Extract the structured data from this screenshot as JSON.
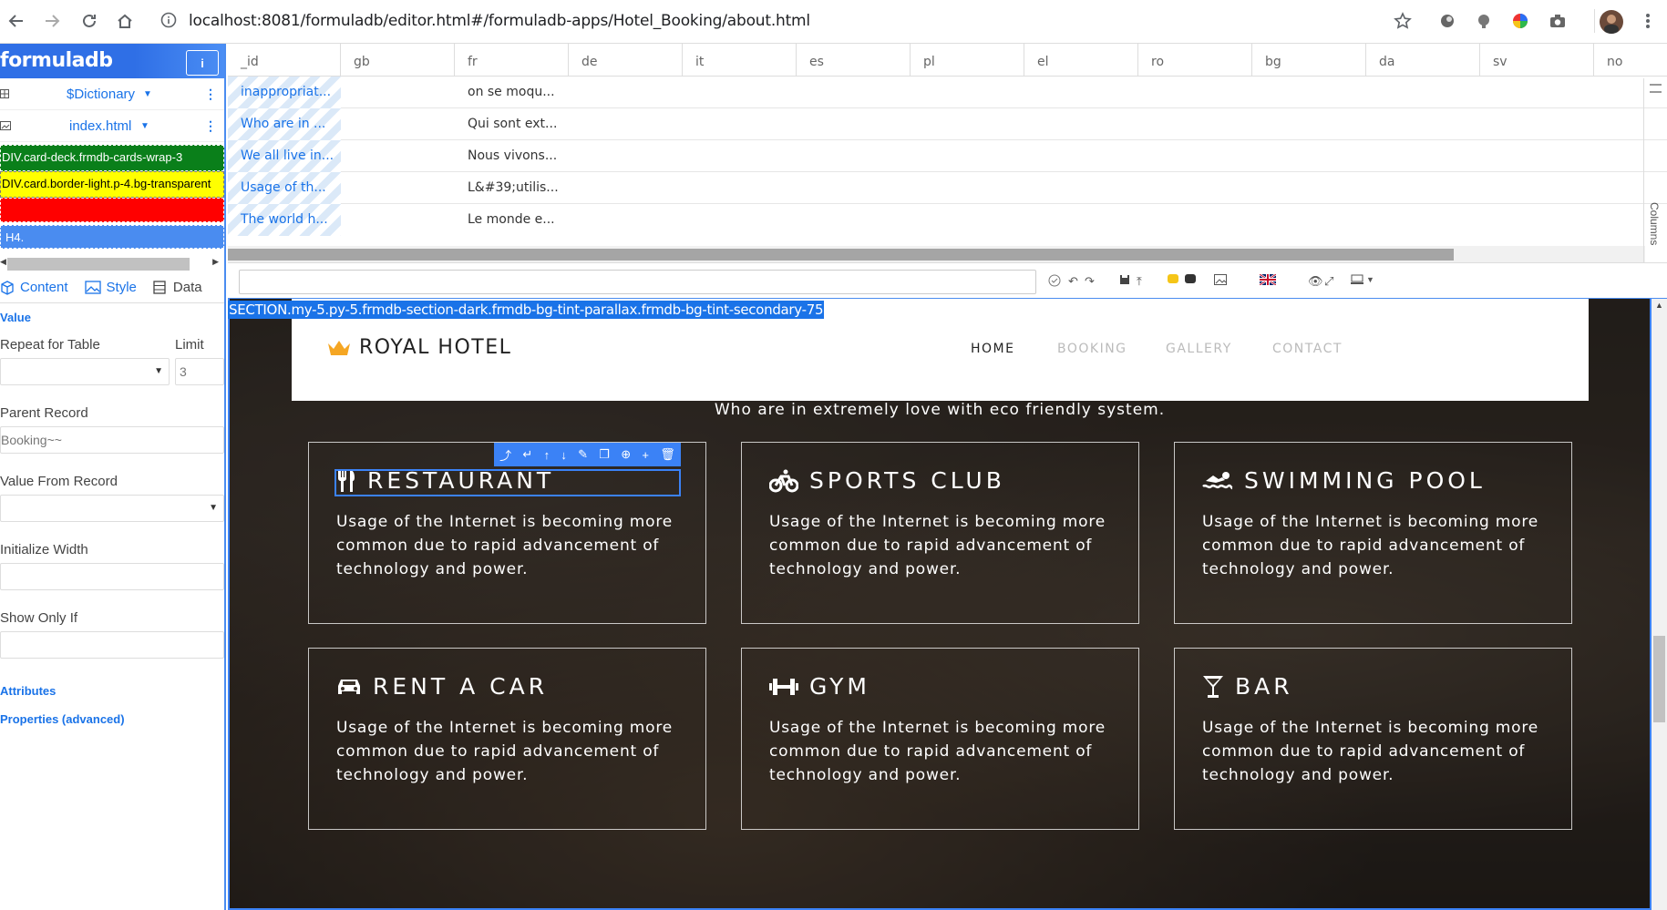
{
  "browser": {
    "url": "localhost:8081/formuladb/editor.html#/formuladb-apps/Hotel_Booking/about.html"
  },
  "sidebar": {
    "logo": "formuladb",
    "logo_button": "i",
    "table_select": "$Dictionary",
    "page_select": "index.html",
    "path": [
      "DIV.card-deck.frmdb-cards-wrap-3",
      "DIV.card.border-light.p-4.bg-transparent",
      "",
      "H4."
    ],
    "tabs": [
      "Content",
      "Style",
      "Data"
    ],
    "value_label": "Value",
    "repeat_label": "Repeat for Table",
    "limit_label": "Limit",
    "limit_value": "3",
    "parent_record_label": "Parent Record",
    "parent_record_value": "Booking~~",
    "value_from_record_label": "Value From Record",
    "initialize_width_label": "Initialize Width",
    "show_only_if_label": "Show Only If",
    "attributes_label": "Attributes",
    "properties_label": "Properties (advanced)"
  },
  "grid": {
    "columns": [
      "_id",
      "gb",
      "fr",
      "de",
      "it",
      "es",
      "pl",
      "el",
      "ro",
      "bg",
      "da",
      "sv",
      "no"
    ],
    "rows": [
      {
        "id": "inappropriat...",
        "fr": "on se moqu..."
      },
      {
        "id": "Who are in ...",
        "fr": "Qui sont ext..."
      },
      {
        "id": "We all live in...",
        "fr": "Nous vivons..."
      },
      {
        "id": "Usage of th...",
        "fr": "L&#39;utilis..."
      },
      {
        "id": "The world h...",
        "fr": "Le monde e..."
      }
    ],
    "side_label": "Columns"
  },
  "selection_label": "SECTION.my-5.py-5.frmdb-section-dark.frmdb-bg-tint-parallax.frmdb-bg-tint-secondary-75",
  "hotel": {
    "brand": "ROYAL HOTEL",
    "nav": [
      "HOME",
      "BOOKING",
      "GALLERY",
      "CONTACT"
    ],
    "subtitle": "Who are in extremely love with eco friendly system.",
    "cards": [
      {
        "title": "RESTAURANT",
        "icon": "utensils-icon",
        "text": "Usage of the Internet is becoming more common due to rapid advancement of technology and power."
      },
      {
        "title": "SPORTS CLUB",
        "icon": "bicycle-icon",
        "text": "Usage of the Internet is becoming more common due to rapid advancement of technology and power."
      },
      {
        "title": "SWIMMING POOL",
        "icon": "swimmer-icon",
        "text": "Usage of the Internet is becoming more common due to rapid advancement of technology and power."
      },
      {
        "title": "RENT A CAR",
        "icon": "car-icon",
        "text": "Usage of the Internet is becoming more common due to rapid advancement of technology and power."
      },
      {
        "title": "GYM",
        "icon": "dumbbell-icon",
        "text": "Usage of the Internet is becoming more common due to rapid advancement of technology and power."
      },
      {
        "title": "BAR",
        "icon": "cocktail-icon",
        "text": "Usage of the Internet is becoming more common due to rapid advancement of technology and power."
      }
    ]
  },
  "colors": {
    "accent": "#1a73e8",
    "path_green": "#0a7f1a",
    "path_yellow": "#ffff00",
    "path_red": "#ff0000",
    "crown": "#f5a623"
  }
}
